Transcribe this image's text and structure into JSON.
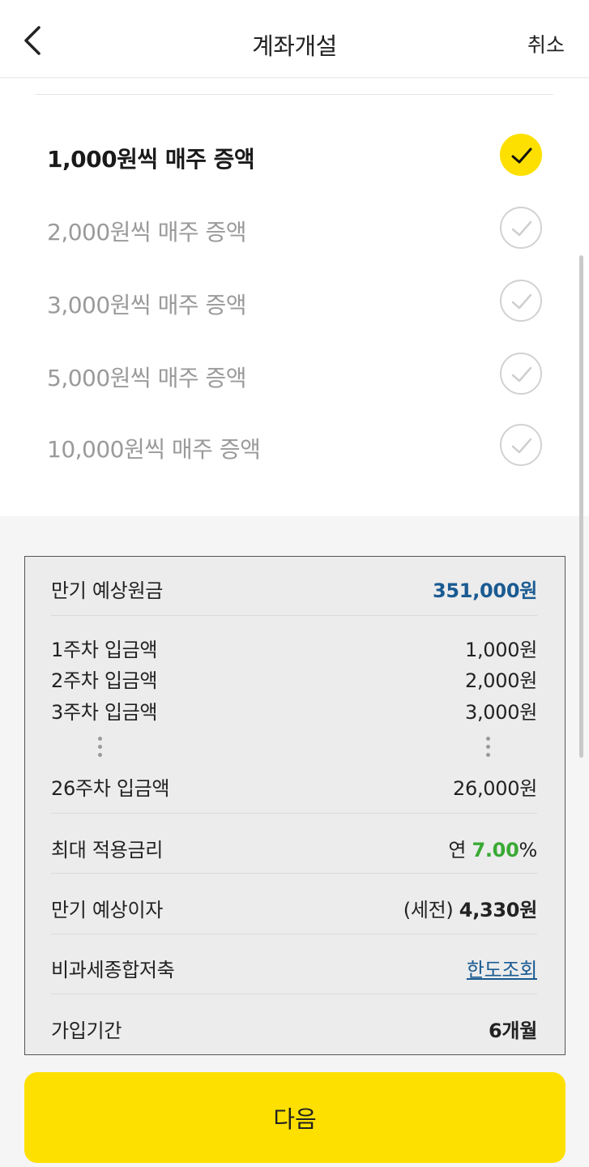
{
  "header": {
    "title": "계좌개설",
    "cancel_label": "취소"
  },
  "options": [
    {
      "label": "1,000원씩 매주 증액",
      "selected": true
    },
    {
      "label": "2,000원씩 매주 증액",
      "selected": false
    },
    {
      "label": "3,000원씩 매주 증액",
      "selected": false
    },
    {
      "label": "5,000원씩 매주 증액",
      "selected": false
    },
    {
      "label": "10,000원씩 매주 증액",
      "selected": false
    }
  ],
  "summary": {
    "maturity_principal_label": "만기 예상원금",
    "maturity_principal_value": "351,000원",
    "weeks": [
      {
        "label": "1주차 입금액",
        "value": "1,000원"
      },
      {
        "label": "2주차 입금액",
        "value": "2,000원"
      },
      {
        "label": "3주차 입금액",
        "value": "3,000원"
      },
      {
        "label": "26주차 입금액",
        "value": "26,000원"
      }
    ],
    "max_rate_label": "최대 적용금리",
    "max_rate_prefix": "연 ",
    "max_rate_value": "7.00",
    "max_rate_suffix": "%",
    "maturity_interest_label": "만기 예상이자",
    "maturity_interest_prefix": "(세전) ",
    "maturity_interest_value": "4,330원",
    "tax_free_label": "비과세종합저축",
    "tax_free_link": "한도조회",
    "period_label": "가입기간",
    "period_value": "6개월"
  },
  "next_button_label": "다음",
  "colors": {
    "accent_yellow": "#fde000",
    "value_blue": "#1a5b92",
    "rate_green": "#3aaa34"
  }
}
